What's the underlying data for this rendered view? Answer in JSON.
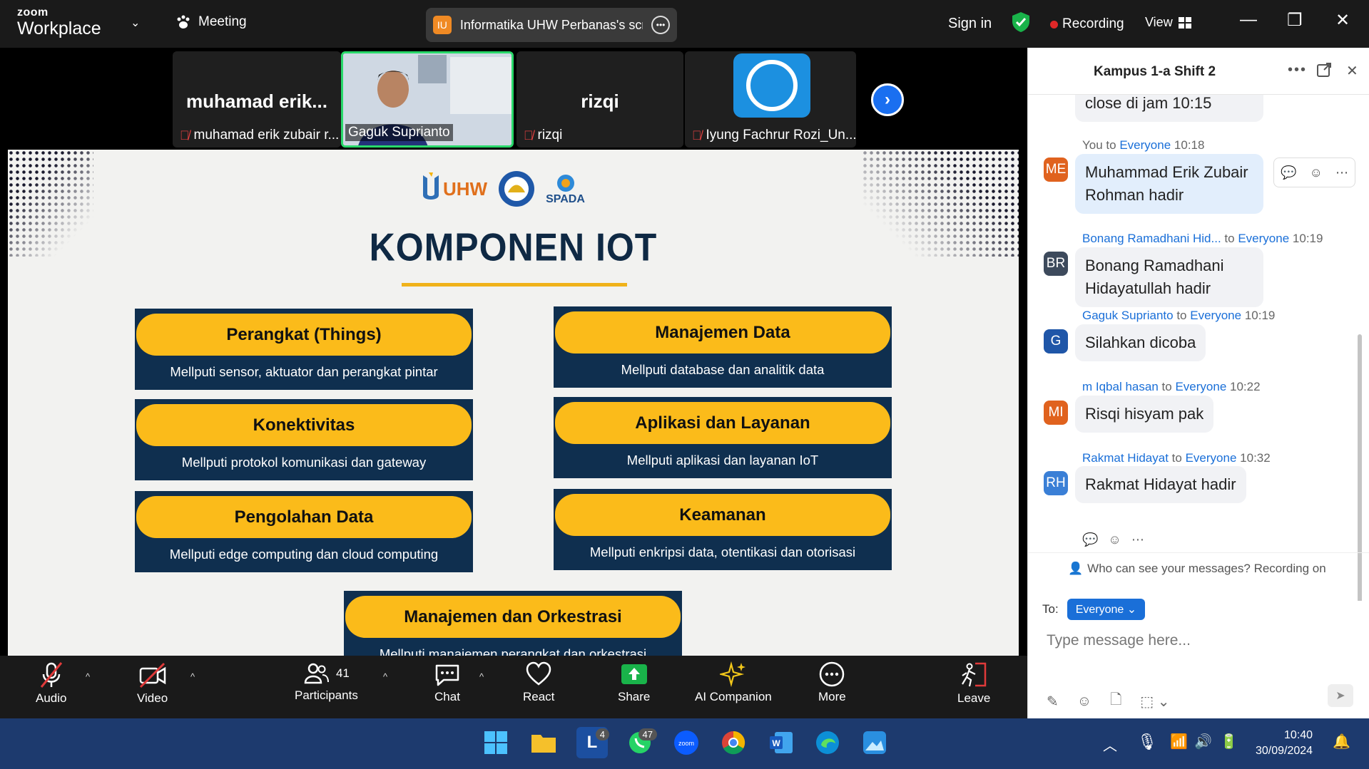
{
  "topbar": {
    "logo_line1": "zoom",
    "logo_line2": "Workplace",
    "meeting_label": "Meeting",
    "share_badge": "IU",
    "share_title": "Informatika UHW Perbanas's scre",
    "signin_label": "Sign in",
    "recording_label": "Recording",
    "view_label": "View"
  },
  "thumbnails": [
    {
      "bigname": "muhamad  erik...",
      "caption": "muhamad erik zubair r...",
      "muted": true
    },
    {
      "bigname": "",
      "caption": "Gaguk Suprianto",
      "muted": false,
      "active": true
    },
    {
      "bigname": "rizqi",
      "caption": "rizqi",
      "muted": true
    },
    {
      "bigname": "",
      "caption": "Iyung Fachrur Rozi_Un...",
      "muted": true
    }
  ],
  "slide": {
    "logo_uhw": "UHW",
    "logo_spada": "SPADA",
    "title": "KOMPONEN IOT",
    "cards": [
      {
        "title": "Perangkat (Things)",
        "desc": "Mellputi sensor, aktuator dan perangkat pintar"
      },
      {
        "title": "Manajemen Data",
        "desc": "Mellputi database dan analitik data"
      },
      {
        "title": "Konektivitas",
        "desc": "Mellputi protokol komunikasi dan gateway"
      },
      {
        "title": "Aplikasi dan Layanan",
        "desc": "Mellputi aplikasi dan layanan IoT"
      },
      {
        "title": "Pengolahan Data",
        "desc": "Mellputi edge computing dan cloud computing"
      },
      {
        "title": "Keamanan",
        "desc": "Mellputi enkripsi data, otentikasi dan otorisasi"
      },
      {
        "title": "Manajemen dan Orkestrasi",
        "desc": "Mellputi manajemen perangkat dan orkestrasi"
      }
    ]
  },
  "toolbar": {
    "audio": "Audio",
    "video": "Video",
    "participants": "Participants",
    "participants_count": "41",
    "chat": "Chat",
    "react": "React",
    "share": "Share",
    "ai": "AI Companion",
    "more": "More",
    "leave": "Leave"
  },
  "chat": {
    "title": "Kampus 1-a Shift 2",
    "messages": [
      {
        "sender": "",
        "to": "",
        "recipient": "",
        "time": "",
        "initials": "",
        "color": "",
        "text": "close di jam 10:15"
      },
      {
        "sender": "You",
        "to": "to",
        "recipient": "Everyone",
        "time": "10:18",
        "initials": "ME",
        "color": "#e0621e",
        "text": "Muhammad Erik Zubair Rohman hadir"
      },
      {
        "sender": "Bonang Ramadhani Hid...",
        "to": "to",
        "recipient": "Everyone",
        "time": "10:19",
        "initials": "BR",
        "color": "#3d4a5c",
        "text": "Bonang Ramadhani Hidayatullah hadir"
      },
      {
        "sender": "Gaguk Suprianto",
        "to": "to",
        "recipient": "Everyone",
        "time": "10:19",
        "initials": "G",
        "color": "#1f56a8",
        "text": "Silahkan dicoba"
      },
      {
        "sender": "m Iqbal hasan",
        "to": "to",
        "recipient": "Everyone",
        "time": "10:22",
        "initials": "MI",
        "color": "#e0621e",
        "text": "Risqi hisyam pak"
      },
      {
        "sender": "Rakmat Hidayat",
        "to": "to",
        "recipient": "Everyone",
        "time": "10:32",
        "initials": "RH",
        "color": "#3a7fd6",
        "text": "Rakmat Hidayat hadir"
      }
    ],
    "visibility": "Who can see your messages? Recording on",
    "to_label": "To:",
    "to_value": "Everyone",
    "placeholder": "Type message here..."
  },
  "taskbar": {
    "badge_l": "4",
    "badge_whatsapp": "47",
    "time": "10:40",
    "date": "30/09/2024"
  }
}
